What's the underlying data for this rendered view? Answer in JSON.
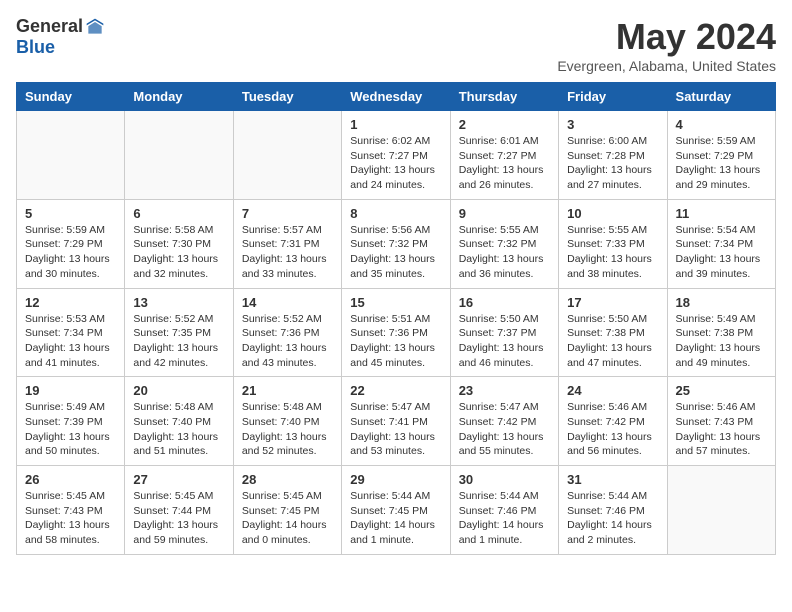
{
  "logo": {
    "general": "General",
    "blue": "Blue"
  },
  "title": "May 2024",
  "location": "Evergreen, Alabama, United States",
  "weekdays": [
    "Sunday",
    "Monday",
    "Tuesday",
    "Wednesday",
    "Thursday",
    "Friday",
    "Saturday"
  ],
  "weeks": [
    [
      {
        "day": "",
        "info": ""
      },
      {
        "day": "",
        "info": ""
      },
      {
        "day": "",
        "info": ""
      },
      {
        "day": "1",
        "info": "Sunrise: 6:02 AM\nSunset: 7:27 PM\nDaylight: 13 hours\nand 24 minutes."
      },
      {
        "day": "2",
        "info": "Sunrise: 6:01 AM\nSunset: 7:27 PM\nDaylight: 13 hours\nand 26 minutes."
      },
      {
        "day": "3",
        "info": "Sunrise: 6:00 AM\nSunset: 7:28 PM\nDaylight: 13 hours\nand 27 minutes."
      },
      {
        "day": "4",
        "info": "Sunrise: 5:59 AM\nSunset: 7:29 PM\nDaylight: 13 hours\nand 29 minutes."
      }
    ],
    [
      {
        "day": "5",
        "info": "Sunrise: 5:59 AM\nSunset: 7:29 PM\nDaylight: 13 hours\nand 30 minutes."
      },
      {
        "day": "6",
        "info": "Sunrise: 5:58 AM\nSunset: 7:30 PM\nDaylight: 13 hours\nand 32 minutes."
      },
      {
        "day": "7",
        "info": "Sunrise: 5:57 AM\nSunset: 7:31 PM\nDaylight: 13 hours\nand 33 minutes."
      },
      {
        "day": "8",
        "info": "Sunrise: 5:56 AM\nSunset: 7:32 PM\nDaylight: 13 hours\nand 35 minutes."
      },
      {
        "day": "9",
        "info": "Sunrise: 5:55 AM\nSunset: 7:32 PM\nDaylight: 13 hours\nand 36 minutes."
      },
      {
        "day": "10",
        "info": "Sunrise: 5:55 AM\nSunset: 7:33 PM\nDaylight: 13 hours\nand 38 minutes."
      },
      {
        "day": "11",
        "info": "Sunrise: 5:54 AM\nSunset: 7:34 PM\nDaylight: 13 hours\nand 39 minutes."
      }
    ],
    [
      {
        "day": "12",
        "info": "Sunrise: 5:53 AM\nSunset: 7:34 PM\nDaylight: 13 hours\nand 41 minutes."
      },
      {
        "day": "13",
        "info": "Sunrise: 5:52 AM\nSunset: 7:35 PM\nDaylight: 13 hours\nand 42 minutes."
      },
      {
        "day": "14",
        "info": "Sunrise: 5:52 AM\nSunset: 7:36 PM\nDaylight: 13 hours\nand 43 minutes."
      },
      {
        "day": "15",
        "info": "Sunrise: 5:51 AM\nSunset: 7:36 PM\nDaylight: 13 hours\nand 45 minutes."
      },
      {
        "day": "16",
        "info": "Sunrise: 5:50 AM\nSunset: 7:37 PM\nDaylight: 13 hours\nand 46 minutes."
      },
      {
        "day": "17",
        "info": "Sunrise: 5:50 AM\nSunset: 7:38 PM\nDaylight: 13 hours\nand 47 minutes."
      },
      {
        "day": "18",
        "info": "Sunrise: 5:49 AM\nSunset: 7:38 PM\nDaylight: 13 hours\nand 49 minutes."
      }
    ],
    [
      {
        "day": "19",
        "info": "Sunrise: 5:49 AM\nSunset: 7:39 PM\nDaylight: 13 hours\nand 50 minutes."
      },
      {
        "day": "20",
        "info": "Sunrise: 5:48 AM\nSunset: 7:40 PM\nDaylight: 13 hours\nand 51 minutes."
      },
      {
        "day": "21",
        "info": "Sunrise: 5:48 AM\nSunset: 7:40 PM\nDaylight: 13 hours\nand 52 minutes."
      },
      {
        "day": "22",
        "info": "Sunrise: 5:47 AM\nSunset: 7:41 PM\nDaylight: 13 hours\nand 53 minutes."
      },
      {
        "day": "23",
        "info": "Sunrise: 5:47 AM\nSunset: 7:42 PM\nDaylight: 13 hours\nand 55 minutes."
      },
      {
        "day": "24",
        "info": "Sunrise: 5:46 AM\nSunset: 7:42 PM\nDaylight: 13 hours\nand 56 minutes."
      },
      {
        "day": "25",
        "info": "Sunrise: 5:46 AM\nSunset: 7:43 PM\nDaylight: 13 hours\nand 57 minutes."
      }
    ],
    [
      {
        "day": "26",
        "info": "Sunrise: 5:45 AM\nSunset: 7:43 PM\nDaylight: 13 hours\nand 58 minutes."
      },
      {
        "day": "27",
        "info": "Sunrise: 5:45 AM\nSunset: 7:44 PM\nDaylight: 13 hours\nand 59 minutes."
      },
      {
        "day": "28",
        "info": "Sunrise: 5:45 AM\nSunset: 7:45 PM\nDaylight: 14 hours\nand 0 minutes."
      },
      {
        "day": "29",
        "info": "Sunrise: 5:44 AM\nSunset: 7:45 PM\nDaylight: 14 hours\nand 1 minute."
      },
      {
        "day": "30",
        "info": "Sunrise: 5:44 AM\nSunset: 7:46 PM\nDaylight: 14 hours\nand 1 minute."
      },
      {
        "day": "31",
        "info": "Sunrise: 5:44 AM\nSunset: 7:46 PM\nDaylight: 14 hours\nand 2 minutes."
      },
      {
        "day": "",
        "info": ""
      }
    ]
  ]
}
